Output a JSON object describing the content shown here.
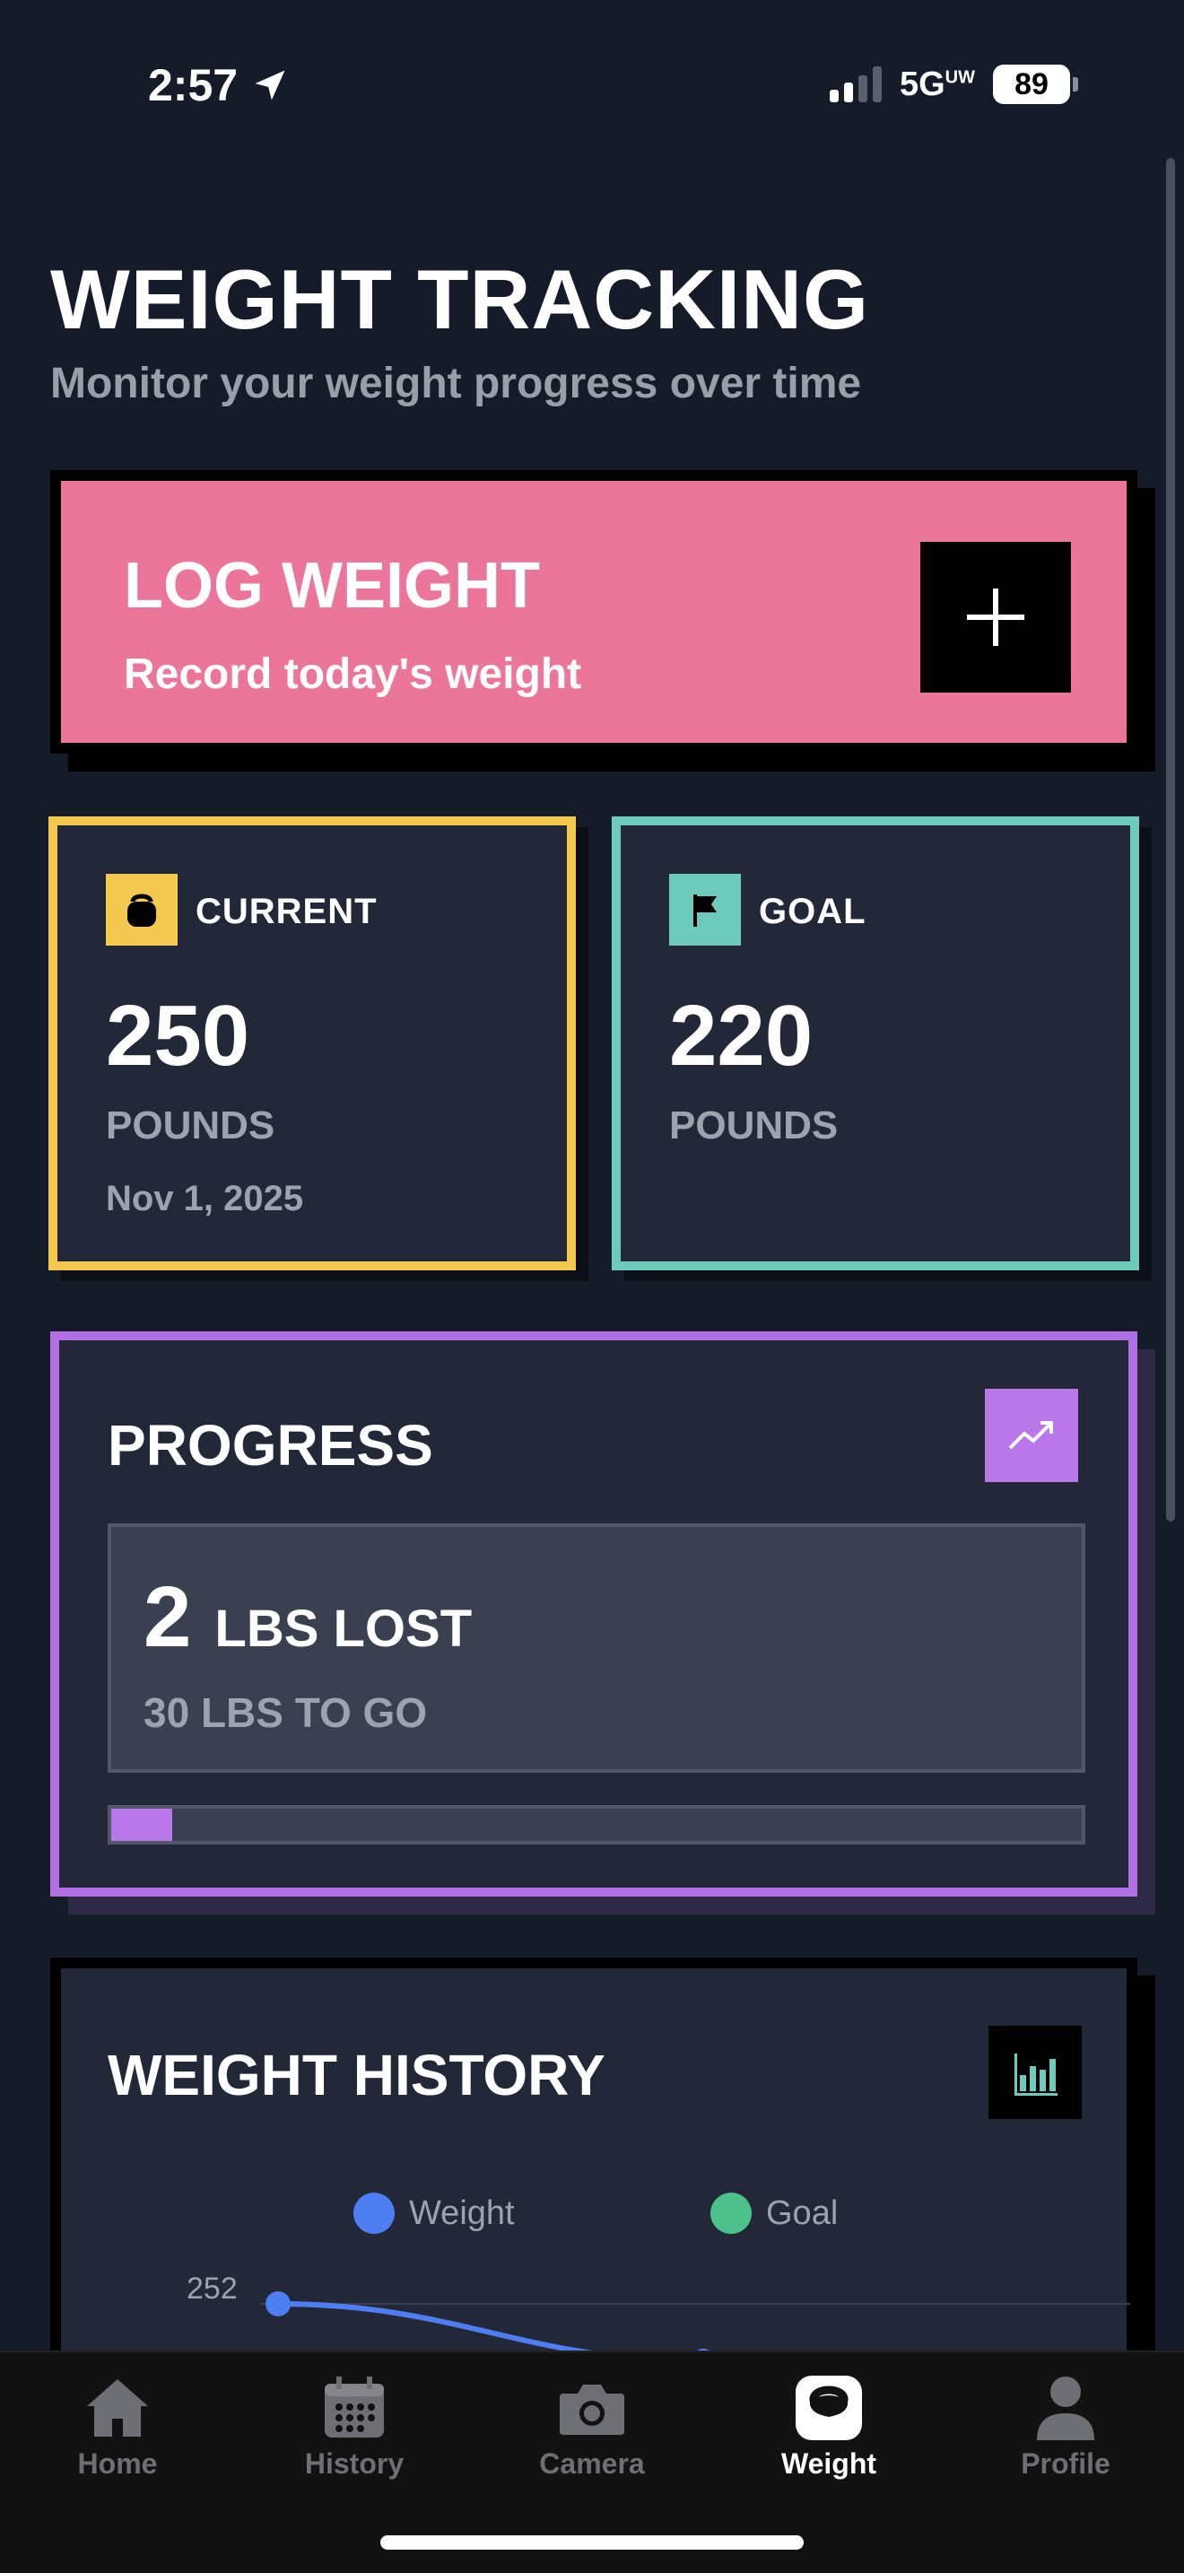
{
  "status_bar": {
    "time": "2:57",
    "network": "5G",
    "network_suffix": "UW",
    "battery": "89"
  },
  "header": {
    "title": "WEIGHT TRACKING",
    "subtitle": "Monitor your weight progress over time"
  },
  "log_card": {
    "title": "LOG WEIGHT",
    "subtitle": "Record today's weight",
    "icon": "plus-icon",
    "color": "#ec7699"
  },
  "current": {
    "label": "CURRENT",
    "value": "250",
    "unit": "POUNDS",
    "date": "Nov 1, 2025",
    "icon": "kettlebell-icon",
    "color": "#f3c94f"
  },
  "goal": {
    "label": "GOAL",
    "value": "220",
    "unit": "POUNDS",
    "icon": "flag-icon",
    "color": "#6ecbbc"
  },
  "progress": {
    "title": "PROGRESS",
    "lost_value": "2",
    "lost_label": "LBS LOST",
    "to_go": "30 LBS TO GO",
    "fraction": 0.0625,
    "icon": "trending-up-icon",
    "color": "#b977ea"
  },
  "history": {
    "title": "WEIGHT HISTORY",
    "icon": "bar-chart-icon",
    "legend": [
      {
        "name": "Weight",
        "color": "#4f7ef2"
      },
      {
        "name": "Goal",
        "color": "#4cc18b"
      }
    ],
    "y_tick": "252"
  },
  "chart_data": {
    "type": "line",
    "series": [
      {
        "name": "Weight",
        "values": [
          252,
          250
        ]
      },
      {
        "name": "Goal",
        "values": []
      }
    ],
    "ylabel": "",
    "xlabel": "",
    "y_ticks": [
      252
    ],
    "legend": "top-center"
  },
  "tabs": [
    {
      "label": "Home",
      "icon": "house-icon",
      "active": false
    },
    {
      "label": "History",
      "icon": "calendar-icon",
      "active": false
    },
    {
      "label": "Camera",
      "icon": "camera-icon",
      "active": false
    },
    {
      "label": "Weight",
      "icon": "kettlebell-icon",
      "active": true
    },
    {
      "label": "Profile",
      "icon": "person-icon",
      "active": false
    }
  ]
}
